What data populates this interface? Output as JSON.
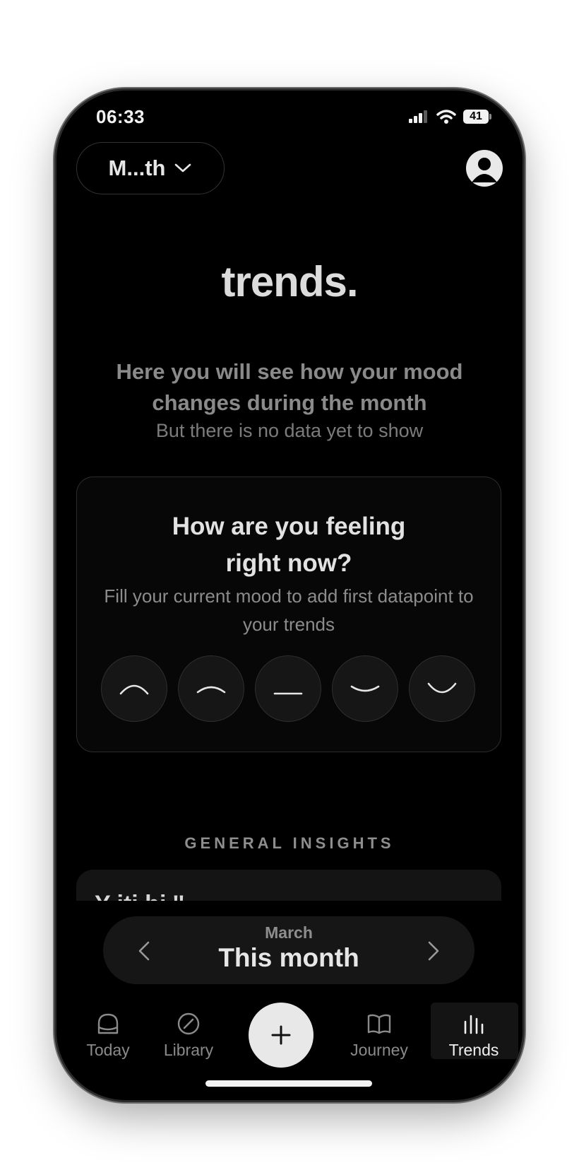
{
  "status_bar": {
    "time": "06:33",
    "battery": "41"
  },
  "header": {
    "period_label": "M...th"
  },
  "title": "trends.",
  "empty_state": {
    "headline": "Here you will see how your mood changes during the month",
    "subline": "But there is no data yet to show"
  },
  "mood_card": {
    "title": "How are you feeling right now?",
    "subtitle": "Fill your current mood to add first datapoint to your trends",
    "faces": [
      "very-sad-face-icon",
      "sad-face-icon",
      "neutral-face-icon",
      "happy-face-icon",
      "very-happy-face-icon"
    ]
  },
  "insights": {
    "label": "GENERAL INSIGHTS",
    "peek_text": "Y                    iti    hi         ''"
  },
  "month_selector": {
    "month": "March",
    "period": "This month"
  },
  "tab_bar": {
    "tabs": [
      {
        "label": "Today"
      },
      {
        "label": "Library"
      },
      {
        "label": "Journey"
      },
      {
        "label": "Trends"
      }
    ]
  },
  "colors": {
    "background": "#000000",
    "accent": "#e8e8e8"
  }
}
